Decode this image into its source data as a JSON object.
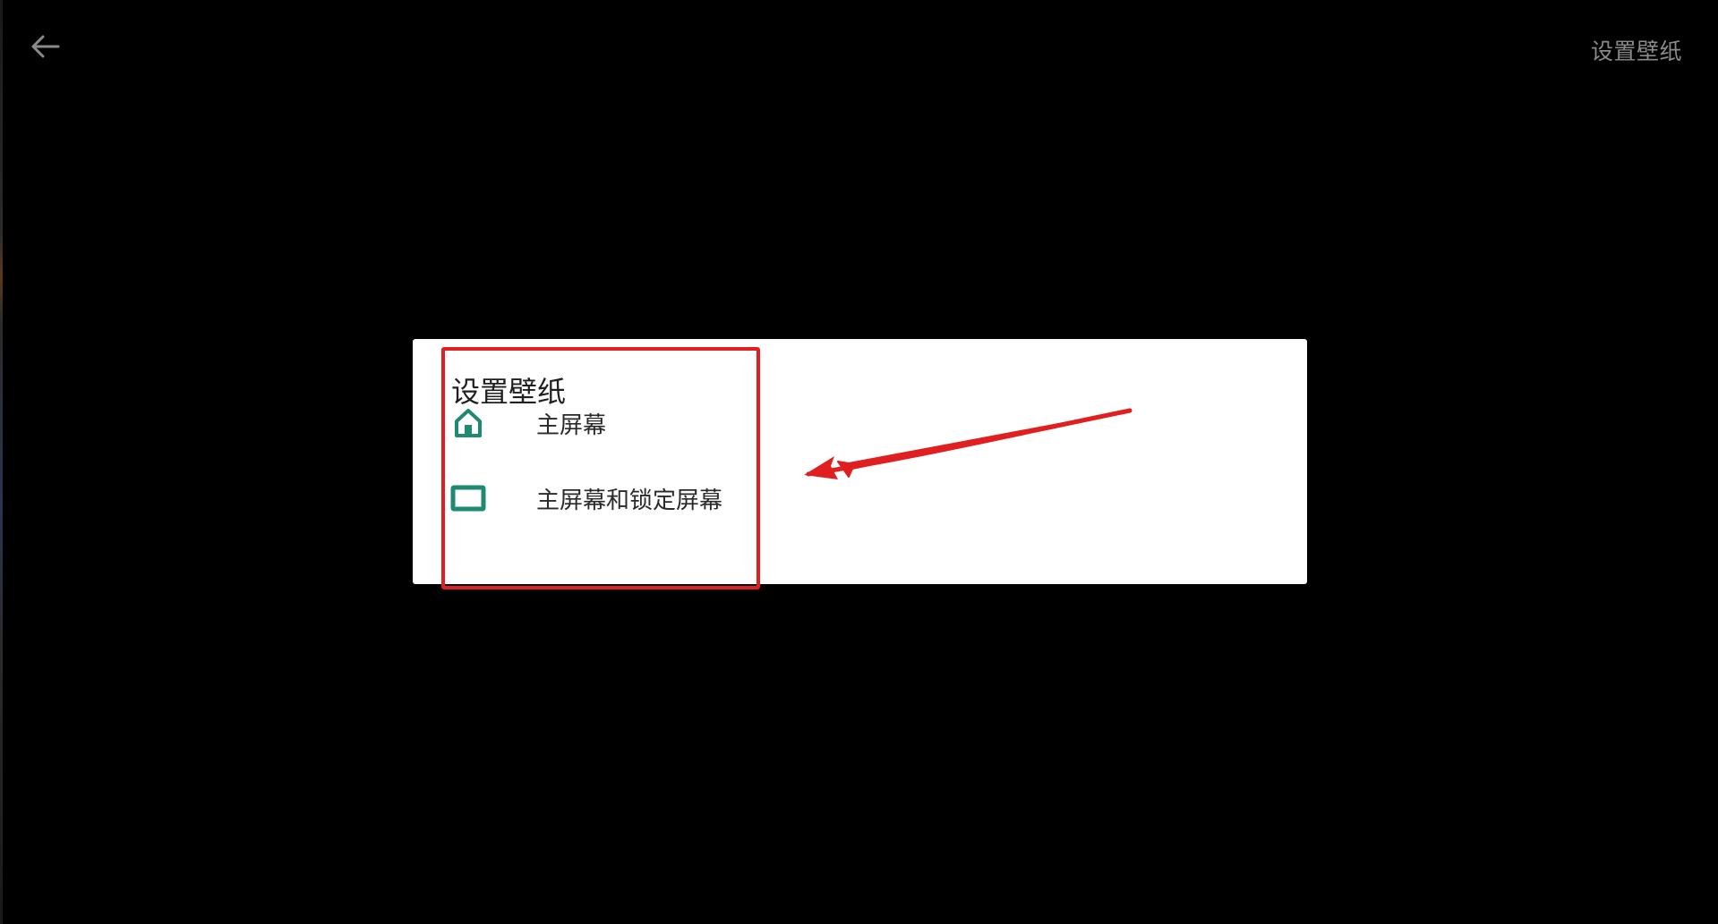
{
  "app_bar": {
    "back_icon": "arrow-left-icon",
    "title": "设置壁纸"
  },
  "dialog": {
    "title": "设置壁纸",
    "options": [
      {
        "label": "主屏幕",
        "icon": "home-icon"
      },
      {
        "label": "主屏幕和锁定屏幕",
        "icon": "screen-icon"
      }
    ]
  },
  "colors": {
    "background": "#000000",
    "accent": "#1e8a72",
    "annotation": "#e02020",
    "title_gray": "#8a8a8a"
  }
}
